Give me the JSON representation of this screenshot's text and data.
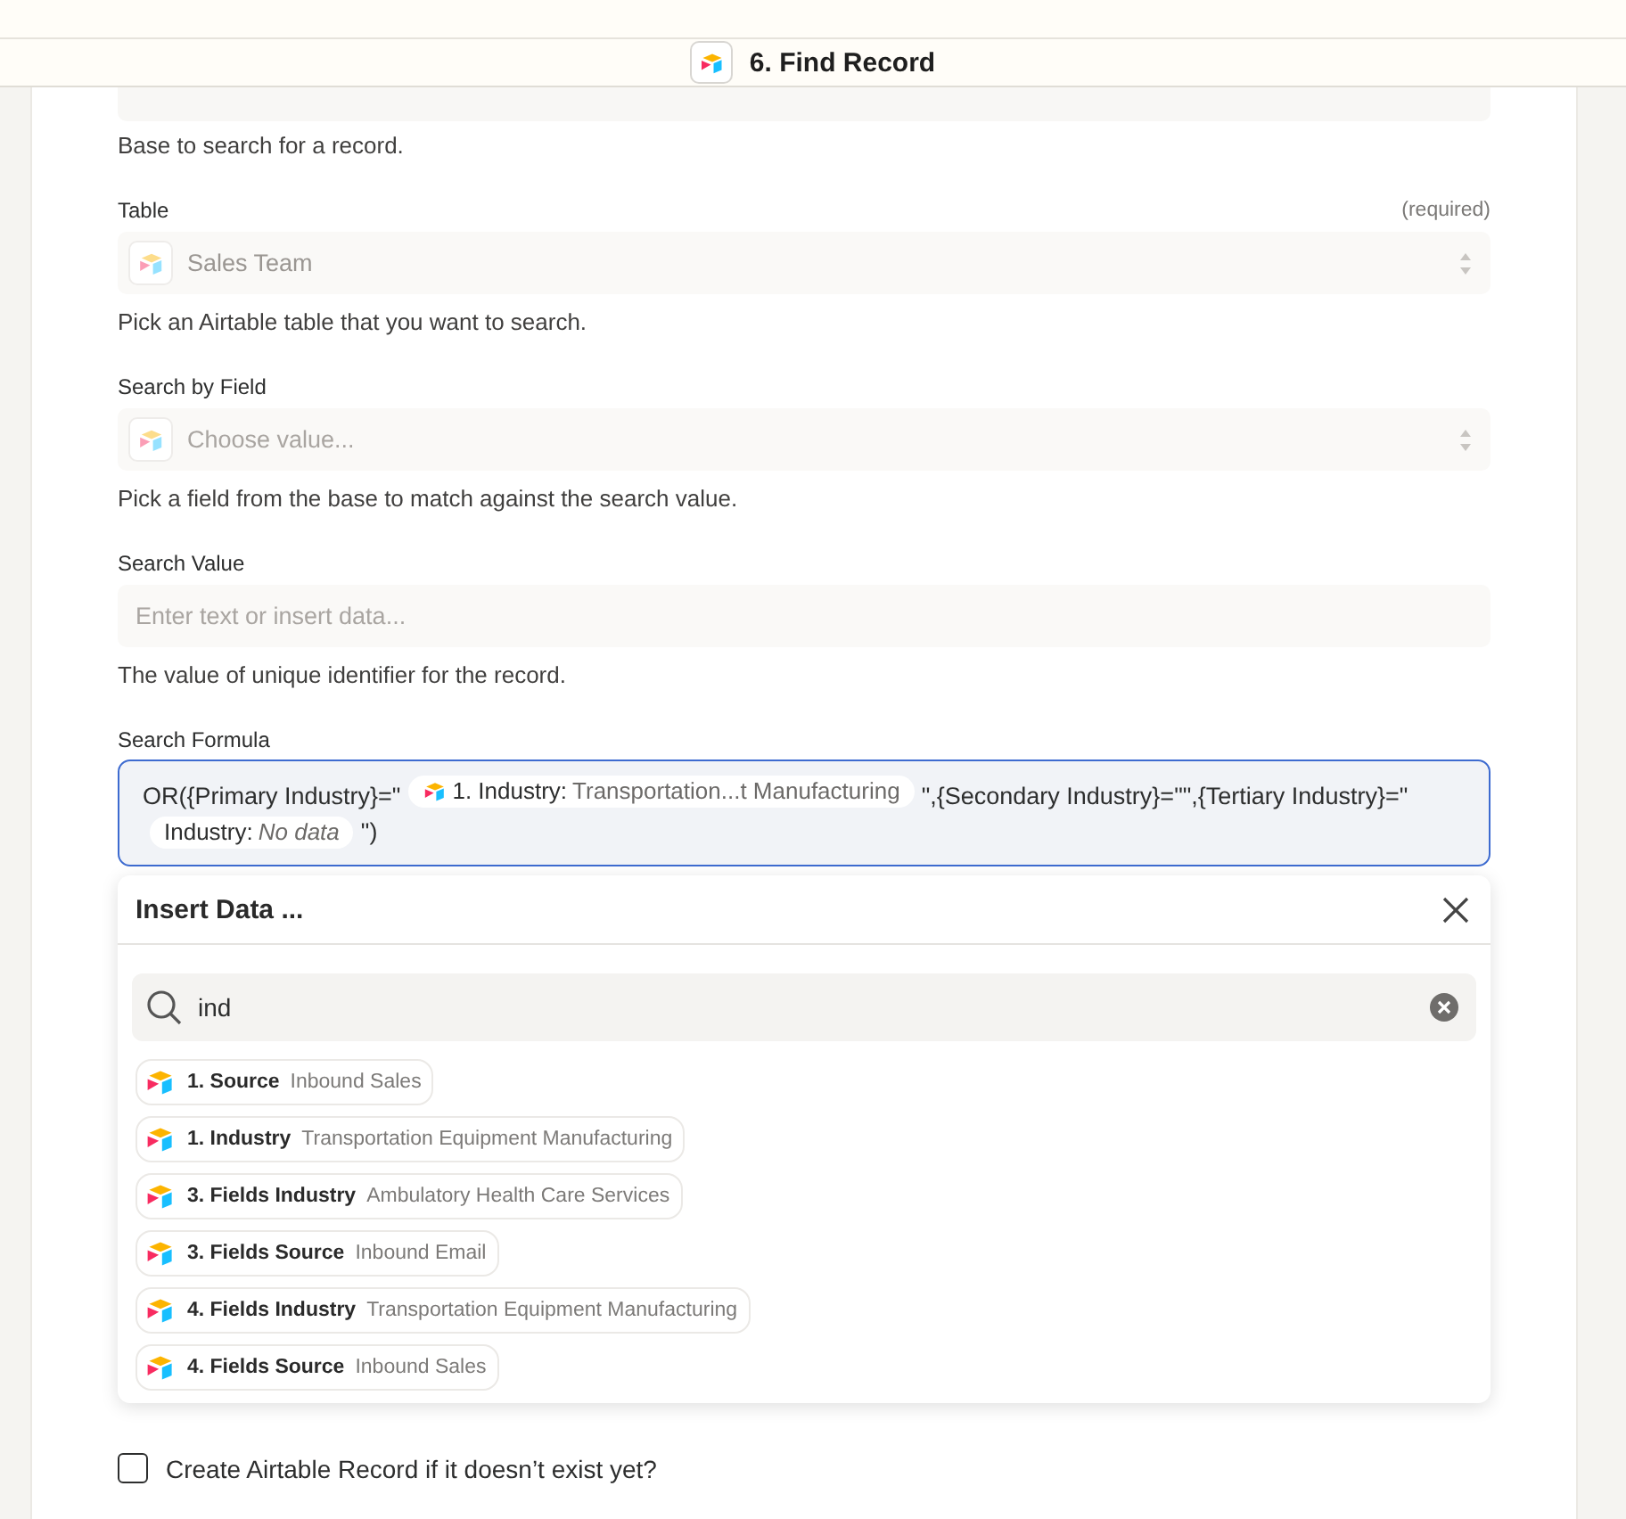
{
  "header": {
    "title": "6. Find Record"
  },
  "base_hint": "Base to search for a record.",
  "fields": [
    {
      "kind": "select",
      "label": "Table",
      "required_note": "(required)",
      "value": "Sales Team",
      "hint": "Pick an Airtable table that you want to search."
    },
    {
      "kind": "select",
      "label": "Search by Field",
      "placeholder": "Choose value...",
      "hint": "Pick a field from the base to match against the search value."
    },
    {
      "kind": "text",
      "label": "Search Value",
      "placeholder": "Enter text or insert data...",
      "hint": "The value of unique identifier for the record."
    }
  ],
  "formula": {
    "label": "Search Formula",
    "parts": [
      {
        "kind": "text",
        "text": "OR({Primary Industry}=\""
      },
      {
        "kind": "pill",
        "app_icon": true,
        "name": "1. Industry:",
        "value": "Transportation...t Manufacturing",
        "empty": false
      },
      {
        "kind": "text",
        "text": "\",{Secondary Industry}=\"\",{Tertiary Industry}=\""
      },
      {
        "kind": "pill",
        "app_icon": false,
        "name": "Industry:",
        "value": "No data",
        "empty": true
      },
      {
        "kind": "text",
        "text": "\")"
      }
    ]
  },
  "insert_data": {
    "title": "Insert Data ...",
    "search": {
      "value": "ind"
    },
    "results": [
      {
        "step": "1. Source",
        "value": "Inbound Sales"
      },
      {
        "step": "1. Industry",
        "value": "Transportation Equipment Manufacturing"
      },
      {
        "step": "3. Fields Industry",
        "value": "Ambulatory Health Care Services"
      },
      {
        "step": "3. Fields Source",
        "value": "Inbound Email"
      },
      {
        "step": "4. Fields Industry",
        "value": "Transportation Equipment Manufacturing"
      },
      {
        "step": "4. Fields Source",
        "value": "Inbound Sales"
      }
    ]
  },
  "checkbox": {
    "label": "Create Airtable Record if it doesn’t exist yet?",
    "checked": false
  }
}
